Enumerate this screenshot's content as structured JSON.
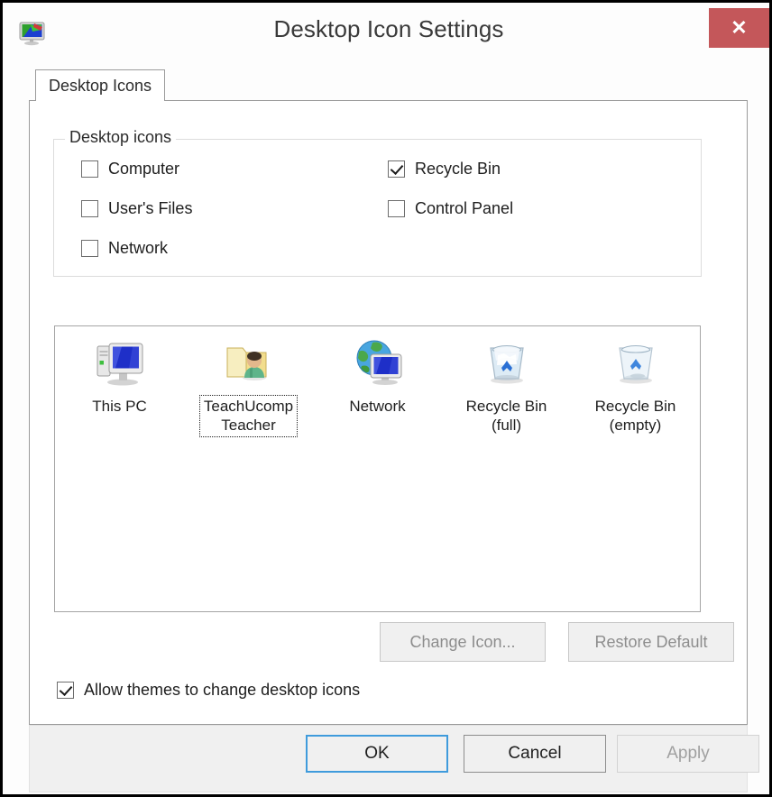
{
  "window": {
    "title": "Desktop Icon Settings",
    "title_icon": "display-monitor-icon",
    "close_label": "✕"
  },
  "tabs": [
    {
      "label": "Desktop Icons",
      "active": true
    }
  ],
  "group": {
    "legend": "Desktop icons",
    "checkboxes": [
      {
        "label": "Computer",
        "checked": false,
        "name": "checkbox-computer",
        "col": 0,
        "row": 0
      },
      {
        "label": "User's Files",
        "checked": false,
        "name": "checkbox-users-files",
        "col": 0,
        "row": 1
      },
      {
        "label": "Network",
        "checked": false,
        "name": "checkbox-network",
        "col": 0,
        "row": 2
      },
      {
        "label": "Recycle Bin",
        "checked": true,
        "name": "checkbox-recycle-bin",
        "col": 1,
        "row": 0
      },
      {
        "label": "Control Panel",
        "checked": false,
        "name": "checkbox-control-panel",
        "col": 1,
        "row": 1
      }
    ]
  },
  "preview": {
    "items": [
      {
        "label": "This PC",
        "icon": "this-pc-icon",
        "selected": false
      },
      {
        "label": "TeachUcomp\nTeacher",
        "icon": "user-folder-icon",
        "selected": true
      },
      {
        "label": "Network",
        "icon": "network-globe-icon",
        "selected": false
      },
      {
        "label": "Recycle Bin\n(full)",
        "icon": "recycle-bin-full-icon",
        "selected": false
      },
      {
        "label": "Recycle Bin\n(empty)",
        "icon": "recycle-bin-empty-icon",
        "selected": false
      }
    ]
  },
  "icon_buttons": {
    "change_icon": {
      "label": "Change Icon...",
      "enabled": false
    },
    "restore_default": {
      "label": "Restore Default",
      "enabled": false
    }
  },
  "allow_themes": {
    "label": "Allow themes to change desktop icons",
    "checked": true
  },
  "footer": {
    "ok": {
      "label": "OK",
      "enabled": true,
      "default": true
    },
    "cancel": {
      "label": "Cancel",
      "enabled": true
    },
    "apply": {
      "label": "Apply",
      "enabled": false
    }
  },
  "colors": {
    "close_button": "#c4575a",
    "focus_border": "#3f9bdc",
    "window_bg": "#fdfdfd",
    "panel_bg": "#ffffff",
    "footer_bg": "#f0f0f0",
    "disabled_text": "#a0a0a0"
  }
}
